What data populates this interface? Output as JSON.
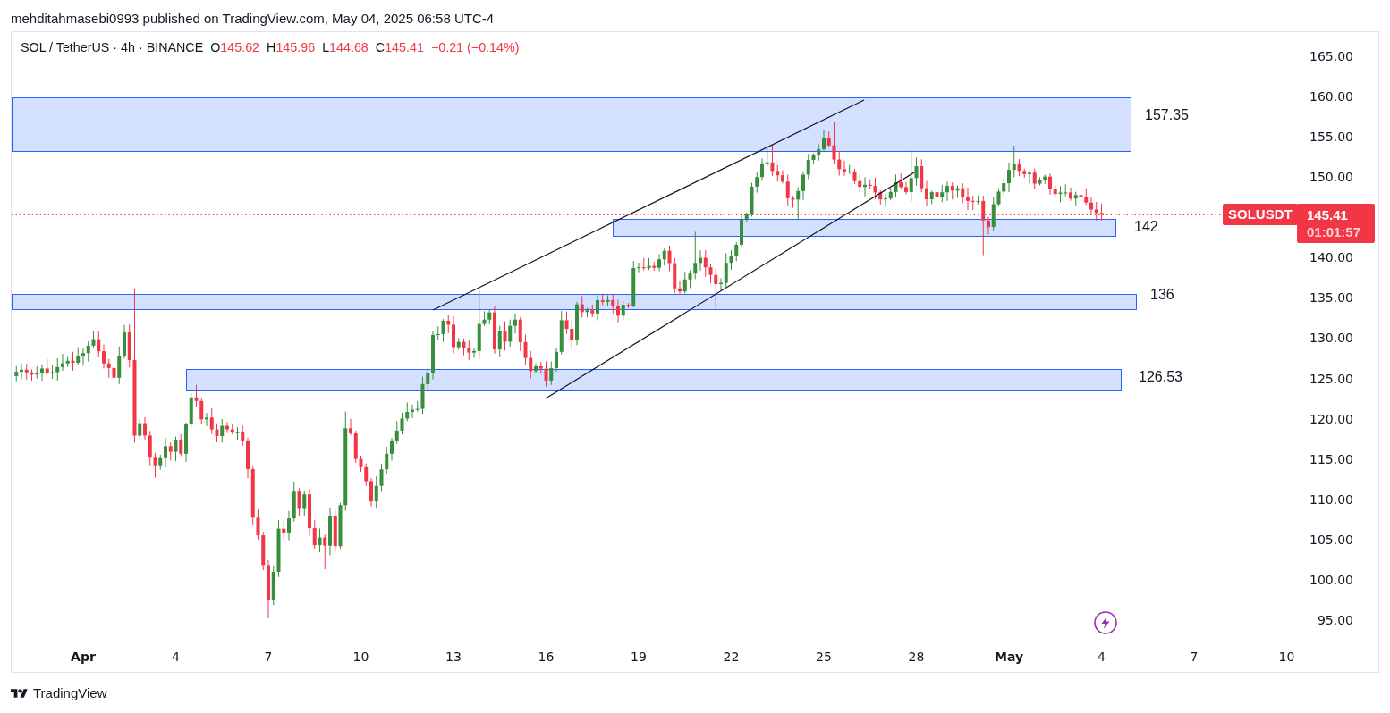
{
  "publish_info": "mehditahmasebi0993 published on TradingView.com, May 04, 2025 06:58 UTC-4",
  "legend": {
    "symbol": "SOL / TetherUS · 4h · BINANCE",
    "falling": true,
    "ohlc": [
      {
        "key": "O",
        "value": "145.62"
      },
      {
        "key": "H",
        "value": "145.96"
      },
      {
        "key": "L",
        "value": "144.68"
      },
      {
        "key": "C",
        "value": "145.41"
      }
    ],
    "change": "−0.21 (−0.14%)"
  },
  "zones": [
    {
      "label": "157.35"
    },
    {
      "label": "142"
    },
    {
      "label": "136"
    },
    {
      "label": "126.53"
    }
  ],
  "last_price": {
    "symbol": "SOLUSDT",
    "price": "145.41",
    "countdown": "01:01:57"
  },
  "price_axis": {
    "ticks": [
      "165.00",
      "160.00",
      "155.00",
      "150.00",
      "140.00",
      "135.00",
      "130.00",
      "125.00",
      "120.00",
      "115.00",
      "110.00",
      "105.00",
      "100.00",
      "95.00"
    ]
  },
  "time_axis": {
    "ticks": [
      {
        "label": "Apr",
        "kind": "month"
      },
      {
        "label": "4",
        "kind": "day"
      },
      {
        "label": "7",
        "kind": "day"
      },
      {
        "label": "10",
        "kind": "day"
      },
      {
        "label": "13",
        "kind": "day"
      },
      {
        "label": "16",
        "kind": "day"
      },
      {
        "label": "19",
        "kind": "day"
      },
      {
        "label": "22",
        "kind": "day"
      },
      {
        "label": "25",
        "kind": "day"
      },
      {
        "label": "28",
        "kind": "day"
      },
      {
        "label": "May",
        "kind": "month"
      },
      {
        "label": "4",
        "kind": "day"
      },
      {
        "label": "7",
        "kind": "day"
      },
      {
        "label": "10",
        "kind": "day"
      }
    ]
  },
  "footer": {
    "brand": "TradingView"
  }
}
